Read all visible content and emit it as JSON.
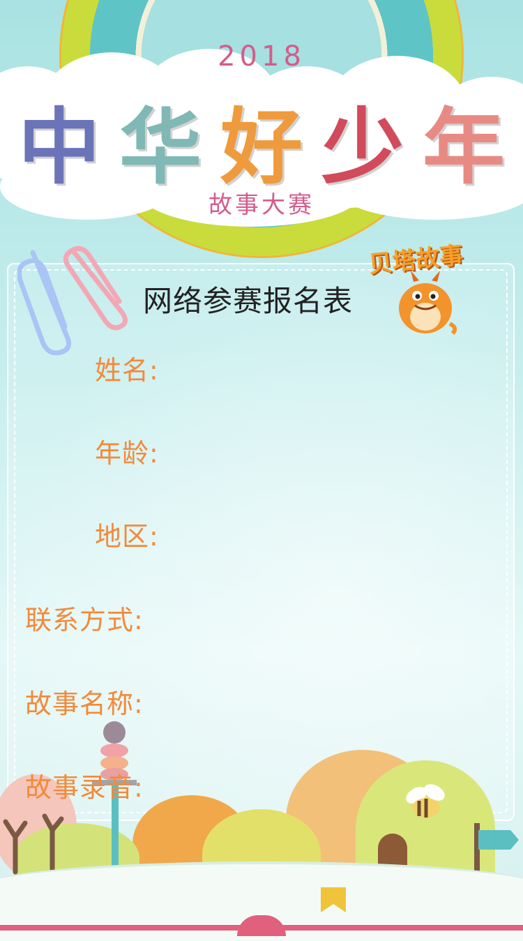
{
  "header": {
    "year": "2018",
    "title_chars": [
      "中",
      "华",
      "好",
      "少",
      "年"
    ],
    "title_colors": [
      "#6b74b8",
      "#7fb8b4",
      "#ef9a3c",
      "#d14b5b",
      "#e88a84"
    ],
    "subtitle": "故事大赛"
  },
  "form": {
    "title": "网络参赛报名表",
    "brand": "贝塔故事",
    "fields": [
      {
        "label": "姓名:"
      },
      {
        "label": "年龄:"
      },
      {
        "label": "地区:"
      },
      {
        "label": "联系方式:"
      },
      {
        "label": "故事名称:"
      },
      {
        "label": "故事录音:"
      }
    ]
  },
  "icons": [
    "paperclip-blue-icon",
    "paperclip-pink-icon",
    "dragon-mascot-icon",
    "bee-icon",
    "signpost-icon",
    "open-book-icon"
  ],
  "colors": {
    "label": "#f28a3a",
    "accent_pink": "#d45c8c",
    "brand_orange": "#f5a02a"
  }
}
